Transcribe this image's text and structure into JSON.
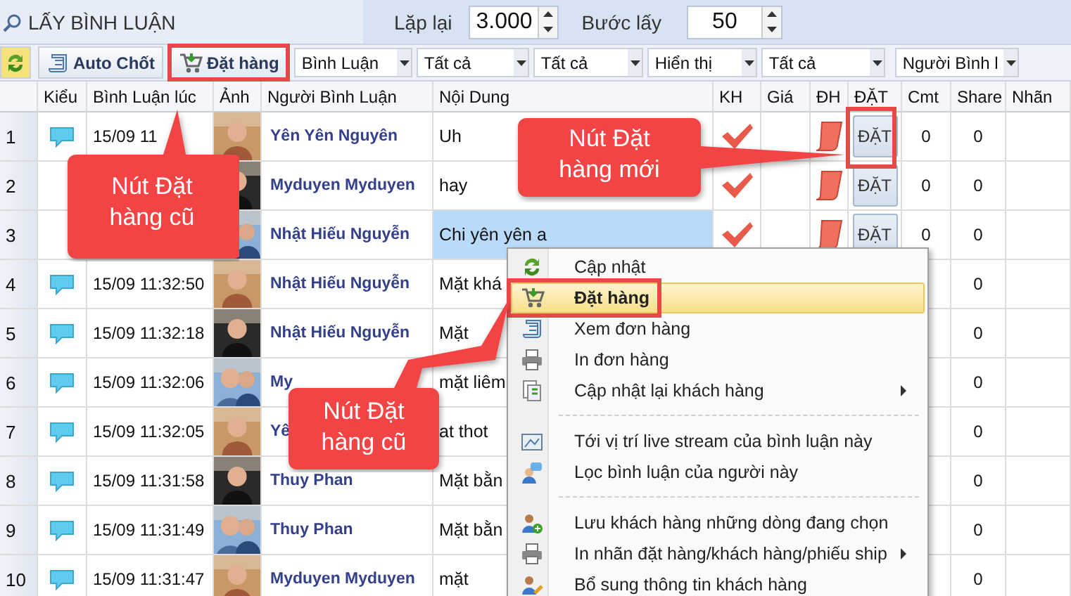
{
  "top_bar": {
    "tab": "LẤY BÌNH LUẬN",
    "repeat_label": "Lặp lại",
    "repeat_value": "3.000",
    "step_label": "Bước lấy",
    "step_value": "50"
  },
  "toolbar": {
    "buttons": [
      {
        "kind": "refresh",
        "highlighted": false
      },
      {
        "kind": "scroll",
        "label": "Auto Chốt",
        "highlighted": false
      },
      {
        "kind": "cart",
        "label": "Đặt hàng",
        "highlighted": true
      }
    ],
    "dropdowns": [
      "Bình Luận",
      "Tất cả",
      "Tất cả",
      "Hiển thị",
      "Tất cả",
      "Người Bình l"
    ]
  },
  "table": {
    "columns": [
      "Kiểu",
      "Bình Luận lúc",
      "Ảnh",
      "Người Bình Luận",
      "Nội Dung",
      "KH",
      "Giá",
      "ĐH",
      "ĐẶT",
      "Cmt",
      "Share",
      "Nhãn"
    ],
    "rows": [
      {
        "number": "1",
        "comment": true,
        "time": "15/09 11",
        "name": "Yên Yên Nguyên",
        "content": "Uh",
        "selected": false,
        "customer_check": true,
        "order_icon": true,
        "order_button": "ĐẶT",
        "order_highlighted": true,
        "cmt": "0",
        "share": "0"
      },
      {
        "number": "2",
        "name": "Myduyen Myduyen",
        "content": "hay",
        "selected": false,
        "customer_check": true,
        "order_icon": true,
        "order_button": "ĐẶT",
        "cmt": "0",
        "share": "0"
      },
      {
        "number": "3",
        "name": "Nhật Hiếu Nguyễn",
        "content": "Chi yên yên a",
        "selected": true,
        "customer_check": true,
        "order_icon": true,
        "order_button": "ĐẶT",
        "cmt": "0",
        "share": "0"
      },
      {
        "number": "4",
        "comment": true,
        "time": "15/09 11:32:50",
        "name": "Nhật Hiếu Nguyễn",
        "content": "Mặt khá",
        "selected": false,
        "share": "0"
      },
      {
        "number": "5",
        "comment": true,
        "time": "15/09 11:32:18",
        "name": "Nhật Hiếu Nguyễn",
        "content": "Mặt",
        "selected": false,
        "share": "0"
      },
      {
        "number": "6",
        "comment": true,
        "time": "15/09 11:32:06",
        "name": "My",
        "content": "mặt liêm",
        "selected": false,
        "share": "0"
      },
      {
        "number": "7",
        "comment": true,
        "time": "15/09 11:32:05",
        "name": "Yê",
        "content": "at thot",
        "selected": false,
        "share": "0"
      },
      {
        "number": "8",
        "comment": true,
        "time": "15/09 11:31:58",
        "name": "Thuy Phan",
        "content": "Mặt bằn",
        "selected": false,
        "share": "0"
      },
      {
        "number": "9",
        "comment": true,
        "time": "15/09 11:31:49",
        "name": "Thuy Phan",
        "content": "Mặt bằn",
        "selected": false,
        "share": "0"
      },
      {
        "number": "10",
        "comment": true,
        "time": "15/09 11:31:47",
        "name": "Myduyen Myduyen",
        "content": "mặt",
        "selected": false,
        "share": "0"
      }
    ]
  },
  "context_menu": {
    "items": [
      {
        "kind": "item",
        "label": "Cập nhật",
        "selected": false,
        "marked": false,
        "submenu": false
      },
      {
        "kind": "item",
        "label": "Đặt hàng",
        "selected": true,
        "marked": true,
        "submenu": false
      },
      {
        "kind": "item",
        "label": "Xem đơn hàng",
        "selected": false,
        "marked": false,
        "submenu": false
      },
      {
        "kind": "item",
        "label": "In đơn hàng",
        "selected": false,
        "marked": false,
        "submenu": false
      },
      {
        "kind": "item",
        "label": "Cập nhật lại khách hàng",
        "selected": false,
        "marked": false,
        "submenu": true
      },
      {
        "kind": "separator"
      },
      {
        "kind": "item",
        "label": "Tới vị trí live stream của bình luận này",
        "selected": false,
        "marked": false,
        "submenu": false
      },
      {
        "kind": "item",
        "label": "Lọc bình luận của người này",
        "selected": false,
        "marked": false,
        "submenu": false
      },
      {
        "kind": "separator"
      },
      {
        "kind": "item",
        "label": "Lưu khách hàng những dòng đang chọn",
        "selected": false,
        "marked": false,
        "submenu": false
      },
      {
        "kind": "item",
        "label": "In nhãn đặt hàng/khách hàng/phiếu ship",
        "selected": false,
        "marked": false,
        "submenu": true
      },
      {
        "kind": "item",
        "label": "Bổ sung thông tin khách hàng",
        "selected": false,
        "marked": false,
        "submenu": false
      }
    ]
  },
  "callouts": [
    {
      "text": "Nút Đặt hàng cũ"
    },
    {
      "text": "Nút Đặt hàng mới"
    },
    {
      "text": "Nút Đặt hàng cũ"
    }
  ]
}
